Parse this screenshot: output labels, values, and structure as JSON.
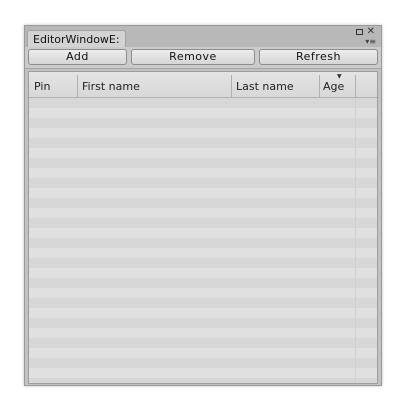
{
  "window": {
    "tab_title": "EditorWindowE:",
    "icons": {
      "maximize": "maximize-icon",
      "close": "close-icon",
      "menu": "menu-icon"
    }
  },
  "toolbar": {
    "add_label": "Add",
    "remove_label": "Remove",
    "refresh_label": "Refresh"
  },
  "table": {
    "columns": [
      "Pin",
      "First name",
      "Last name",
      "Age"
    ],
    "sorted_column": "Age",
    "sort_icon": "sort-desc-icon",
    "rows": []
  },
  "colors": {
    "window_bg": "#c2c2c2",
    "row_stripe_a": "#d7d7d7",
    "row_stripe_b": "#e0e0e0"
  }
}
